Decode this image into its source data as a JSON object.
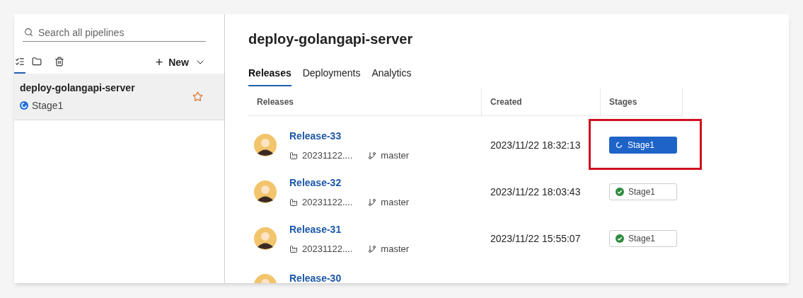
{
  "sidebar": {
    "search": {
      "placeholder": "Search all pipelines"
    },
    "toolbar": [
      {
        "kind": "list",
        "selected": true
      },
      {
        "kind": "folder",
        "selected": false
      },
      {
        "kind": "trash",
        "selected": false
      }
    ],
    "new_button": {
      "label": "New",
      "plus": "+"
    },
    "items": [
      {
        "name": "deploy-golangapi-server",
        "stage": "Stage1",
        "kind": "running",
        "selected": true,
        "favorite": false
      }
    ]
  },
  "main": {
    "title": "deploy-golangapi-server",
    "tabs": [
      {
        "label": "Releases",
        "selected": true
      },
      {
        "label": "Deployments",
        "selected": false
      },
      {
        "label": "Analytics",
        "selected": false
      }
    ],
    "table": {
      "columns": [
        "Releases",
        "Created",
        "Stages"
      ],
      "rows": [
        {
          "name": "Release-33",
          "artifact": "20231122....",
          "branch": "master",
          "created": "2023/11/22 18:32:13",
          "stage": {
            "label": "Stage1",
            "kind": "running",
            "highlighted": true
          }
        },
        {
          "name": "Release-32",
          "artifact": "20231122....",
          "branch": "master",
          "created": "2023/11/22 18:03:43",
          "stage": {
            "label": "Stage1",
            "kind": "succeeded",
            "highlighted": false
          }
        },
        {
          "name": "Release-31",
          "artifact": "20231122....",
          "branch": "master",
          "created": "2023/11/22 15:55:07",
          "stage": {
            "label": "Stage1",
            "kind": "succeeded",
            "highlighted": false
          }
        },
        {
          "name": "Release-30"
        }
      ]
    }
  }
}
